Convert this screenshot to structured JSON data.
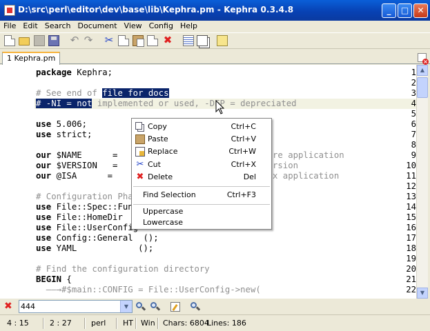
{
  "window": {
    "title": "D:\\src\\perl\\editor\\dev\\base\\lib\\Kephra.pm - Kephra 0.3.4.8",
    "minimize_label": "_",
    "maximize_label": "□",
    "close_label": "✕"
  },
  "menu": [
    "File",
    "Edit",
    "Search",
    "Document",
    "View",
    "Config",
    "Help"
  ],
  "toolbar_icons": [
    "new-file-icon",
    "open-file-icon",
    "save-all-icon",
    "save-icon",
    "undo-icon",
    "redo-icon",
    "cut-icon",
    "copy-icon",
    "paste-icon",
    "replace-icon",
    "delete-icon",
    "comment-icon",
    "window-icon",
    "notes-icon"
  ],
  "tabs": [
    {
      "label": "1 Kephra.pm"
    }
  ],
  "editor": {
    "lines": [
      {
        "no": "1",
        "text": "package Kephra;"
      },
      {
        "no": "2",
        "text": ""
      },
      {
        "no": "3",
        "pre": "# See end of ",
        "selected": "file for docs"
      },
      {
        "no": "4",
        "selected_full": "# -NI = not",
        "rest": " implemented or used, -DEP = depreciated"
      },
      {
        "no": "5",
        "text": ""
      },
      {
        "no": "6",
        "kw": "use",
        "text": " 5.006;"
      },
      {
        "no": "7",
        "kw": "use",
        "text": " strict;"
      },
      {
        "no": "8",
        "text": ""
      },
      {
        "no": "9",
        "kw": "our",
        "text": " $NAME      =",
        "tail": "re application"
      },
      {
        "no": "10",
        "kw": "our",
        "text": " $VERSION   =",
        "tail": "rsion"
      },
      {
        "no": "11",
        "kw": "our",
        "text": " @ISA      =",
        "tail": "x application"
      },
      {
        "no": "12",
        "text": ""
      },
      {
        "no": "13",
        "comment": "# Configuration Pha"
      },
      {
        "no": "14",
        "kw": "use",
        "text": " File::Spec::Fun"
      },
      {
        "no": "15",
        "kw": "use",
        "text": " File::HomeDir"
      },
      {
        "no": "16",
        "kw": "use",
        "text": " File::UserConfig"
      },
      {
        "no": "17",
        "kw": "use",
        "text": " Config::General  ();"
      },
      {
        "no": "18",
        "kw": "use",
        "text": " YAML            ();"
      },
      {
        "no": "19",
        "text": ""
      },
      {
        "no": "20",
        "comment": "# Find the configuration directory"
      },
      {
        "no": "21",
        "kw": "BEGIN",
        "text": " {"
      },
      {
        "no": "22",
        "text": "  ——→#$main::CONFIG = File::UserConfig->new("
      }
    ]
  },
  "context_menu": {
    "items": [
      {
        "icon": "copy-icon",
        "label": "Copy",
        "shortcut": "Ctrl+C"
      },
      {
        "icon": "paste-icon",
        "label": "Paste",
        "shortcut": "Ctrl+V"
      },
      {
        "icon": "replace-icon",
        "label": "Replace",
        "shortcut": "Ctrl+W"
      },
      {
        "icon": "cut-icon",
        "label": "Cut",
        "shortcut": "Ctrl+X"
      },
      {
        "icon": "delete-icon",
        "label": "Delete",
        "shortcut": "Del"
      },
      {
        "label": "Find Selection",
        "shortcut": "Ctrl+F3"
      },
      {
        "label": "Uppercase"
      },
      {
        "label": "Lowercase"
      }
    ]
  },
  "search": {
    "value": "444"
  },
  "status": {
    "cursor": "4 : 15",
    "selection": "2 : 27",
    "language": "perl",
    "tab_mode": "HT",
    "line_ending": "Win",
    "chars": "Chars: 6804",
    "lines": "Lines: 186"
  },
  "colors": {
    "selection": "#0a246a",
    "titlebar": "#0842b4",
    "current_line": "#f2f2e2"
  }
}
